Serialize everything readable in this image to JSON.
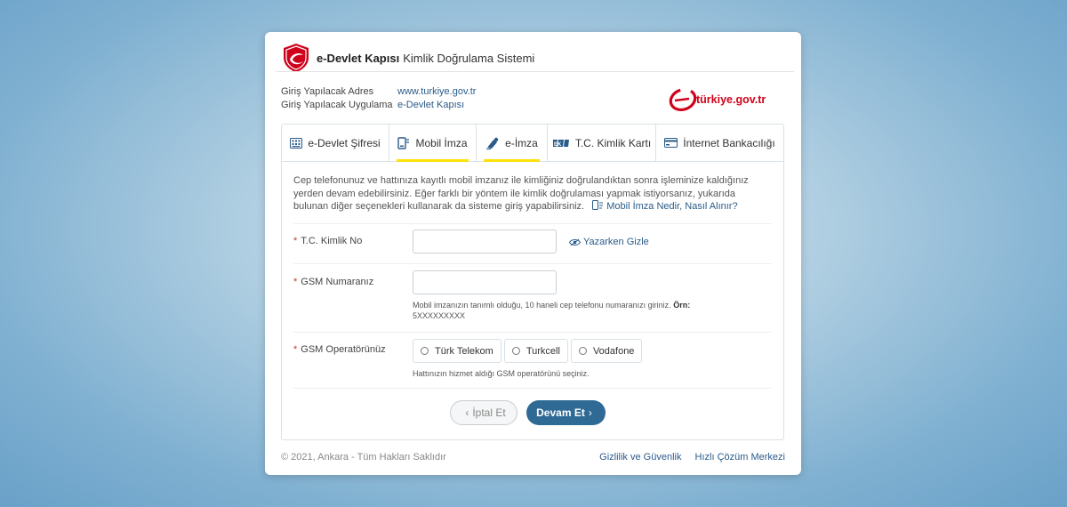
{
  "header": {
    "brand_bold": "e-Devlet Kapısı",
    "brand_light": "Kimlik Doğrulama Sistemi"
  },
  "info": {
    "rows": [
      {
        "label": "Giriş Yapılacak Adres",
        "value": "www.turkiye.gov.tr"
      },
      {
        "label": "Giriş Yapılacak Uygulama",
        "value": "e-Devlet Kapısı"
      }
    ],
    "logo_text": "türkiye.gov.tr"
  },
  "tabs": [
    {
      "label": "e-Devlet Şifresi",
      "icon": "keypad-icon"
    },
    {
      "label": "Mobil İmza",
      "icon": "mobile-signature-icon"
    },
    {
      "label": "e-İmza",
      "icon": "pen-signature-icon"
    },
    {
      "label": "T.C. Kimlik Kartı",
      "icon": "id-card-icon"
    },
    {
      "label": "İnternet Bankacılığı",
      "icon": "bank-card-icon"
    }
  ],
  "description": {
    "text": "Cep telefonunuz ve hattınıza kayıtlı mobil imzanız ile kimliğiniz doğrulandıktan sonra işleminize kaldığınız yerden devam edebilirsiniz. Eğer farklı bir yöntem ile kimlik doğrulaması yapmak istiyorsanız, yukarıda bulunan diğer seçenekleri kullanarak da sisteme giriş yapabilirsiniz.",
    "link": "Mobil İmza Nedir, Nasıl Alınır?"
  },
  "form": {
    "tc_label": "T.C. Kimlik No",
    "tc_value": "",
    "toggle_link": "Yazarken Gizle",
    "gsm_label": "GSM Numaranız",
    "gsm_value": "",
    "gsm_hint": "Mobil imzanızın tanımlı olduğu, 10 haneli cep telefonu numaranızı giriniz.",
    "gsm_hint_example_label": "Örn:",
    "gsm_hint_example": "5XXXXXXXXX",
    "operator_label": "GSM Operatörünüz",
    "operators": [
      "Türk Telekom",
      "Turkcell",
      "Vodafone"
    ],
    "operator_hint": "Hattınızın hizmet aldığı GSM operatörünü seçiniz.",
    "required_mark": "*"
  },
  "buttons": {
    "cancel": "İptal Et",
    "next": "Devam Et"
  },
  "footer": {
    "copyright": "© 2021, Ankara - Tüm Hakları Saklıdır",
    "links": [
      "Gizlilik ve Güvenlik",
      "Hızlı Çözüm Merkezi"
    ]
  },
  "colors": {
    "brand_red": "#d0021b",
    "link_blue": "#2a5b8a",
    "primary_button": "#2f6a95",
    "highlight": "#ffe20a"
  }
}
